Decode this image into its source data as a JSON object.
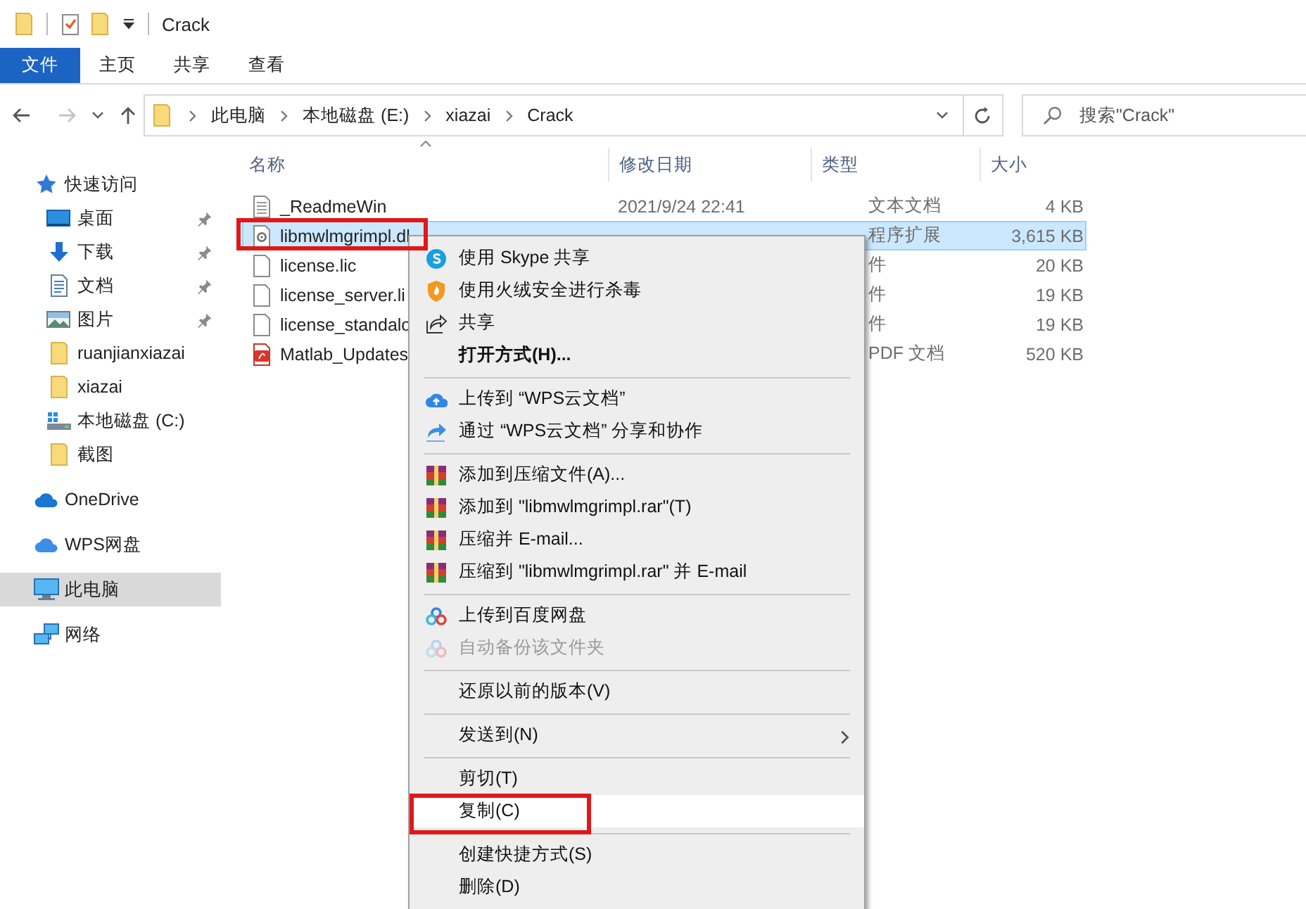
{
  "title_bar": {
    "title": "Crack"
  },
  "ribbon_tabs": [
    {
      "label": "文件",
      "kind": "file"
    },
    {
      "label": "主页",
      "kind": "tab"
    },
    {
      "label": "共享",
      "kind": "tab"
    },
    {
      "label": "查看",
      "kind": "tab"
    }
  ],
  "navigation": {
    "back_disabled": false,
    "forward_disabled": true
  },
  "address_bar": {
    "breadcrumbs": [
      "此电脑",
      "本地磁盘 (E:)",
      "xiazai",
      "Crack"
    ]
  },
  "search": {
    "placeholder": "搜索\"Crack\""
  },
  "sidebar": {
    "items": [
      {
        "label": "快速访问",
        "selected": false,
        "children": [
          {
            "label": "桌面",
            "pinned": true,
            "selected": false
          },
          {
            "label": "下载",
            "pinned": true,
            "selected": false
          },
          {
            "label": "文档",
            "pinned": true,
            "selected": false
          },
          {
            "label": "图片",
            "pinned": true,
            "selected": false
          },
          {
            "label": "ruanjianxiazai",
            "pinned": false,
            "selected": false
          },
          {
            "label": "xiazai",
            "pinned": false,
            "selected": false
          },
          {
            "label": "本地磁盘 (C:)",
            "pinned": false,
            "selected": false
          },
          {
            "label": "截图",
            "pinned": false,
            "selected": false
          }
        ]
      },
      {
        "label": "OneDrive",
        "selected": false
      },
      {
        "label": "WPS网盘",
        "selected": false
      },
      {
        "label": "此电脑",
        "selected": true
      },
      {
        "label": "网络",
        "selected": false
      }
    ]
  },
  "file_list": {
    "columns": [
      {
        "label": "名称",
        "sorted": true
      },
      {
        "label": "修改日期",
        "sorted": false
      },
      {
        "label": "类型",
        "sorted": false
      },
      {
        "label": "大小",
        "sorted": false
      }
    ],
    "rows": [
      {
        "name": "_ReadmeWin",
        "modified": "2021/9/24 22:41",
        "type": "文本文档",
        "size": "4 KB",
        "selected": false,
        "highlighted": false
      },
      {
        "name": "libmwlmgrimpl.dl",
        "type": "程序扩展",
        "size": "3,615 KB",
        "selected": true,
        "highlighted": true
      },
      {
        "name": "license.lic",
        "type": "件",
        "size": "20 KB",
        "selected": false,
        "highlighted": false
      },
      {
        "name": "license_server.li",
        "type": "件",
        "size": "19 KB",
        "selected": false,
        "highlighted": false
      },
      {
        "name": "license_standalo",
        "type": "件",
        "size": "19 KB",
        "selected": false,
        "highlighted": false
      },
      {
        "name": "Matlab_Updates",
        "type": "PDF 文档",
        "size": "520 KB",
        "selected": false,
        "highlighted": false
      }
    ]
  },
  "context_menu": {
    "items": [
      {
        "kind": "item",
        "label": "使用 Skype 共享",
        "bold": false,
        "disabled": false,
        "hovered": false,
        "highlighted": false,
        "submenu": false
      },
      {
        "kind": "item",
        "label": "使用火绒安全进行杀毒",
        "bold": false,
        "disabled": false,
        "hovered": false,
        "highlighted": false,
        "submenu": false
      },
      {
        "kind": "item",
        "label": "共享",
        "bold": false,
        "disabled": false,
        "hovered": false,
        "highlighted": false,
        "submenu": false
      },
      {
        "kind": "item",
        "label": "打开方式(H)...",
        "bold": true,
        "disabled": false,
        "hovered": false,
        "highlighted": false,
        "submenu": false
      },
      {
        "kind": "separator"
      },
      {
        "kind": "item",
        "label": "上传到 “WPS云文档”",
        "bold": false,
        "disabled": false,
        "hovered": false,
        "highlighted": false,
        "submenu": false
      },
      {
        "kind": "item",
        "label": "通过 “WPS云文档” 分享和协作",
        "bold": false,
        "disabled": false,
        "hovered": false,
        "highlighted": false,
        "submenu": false
      },
      {
        "kind": "separator"
      },
      {
        "kind": "item",
        "label": "添加到压缩文件(A)...",
        "bold": false,
        "disabled": false,
        "hovered": false,
        "highlighted": false,
        "submenu": false
      },
      {
        "kind": "item",
        "label": "添加到 \"libmwlmgrimpl.rar\"(T)",
        "bold": false,
        "disabled": false,
        "hovered": false,
        "highlighted": false,
        "submenu": false
      },
      {
        "kind": "item",
        "label": "压缩并 E-mail...",
        "bold": false,
        "disabled": false,
        "hovered": false,
        "highlighted": false,
        "submenu": false
      },
      {
        "kind": "item",
        "label": "压缩到 \"libmwlmgrimpl.rar\" 并 E-mail",
        "bold": false,
        "disabled": false,
        "hovered": false,
        "highlighted": false,
        "submenu": false
      },
      {
        "kind": "separator"
      },
      {
        "kind": "item",
        "label": "上传到百度网盘",
        "bold": false,
        "disabled": false,
        "hovered": false,
        "highlighted": false,
        "submenu": false
      },
      {
        "kind": "item",
        "label": "自动备份该文件夹",
        "bold": false,
        "disabled": true,
        "hovered": false,
        "highlighted": false,
        "submenu": false
      },
      {
        "kind": "separator"
      },
      {
        "kind": "item",
        "label": "还原以前的版本(V)",
        "bold": false,
        "disabled": false,
        "hovered": false,
        "highlighted": false,
        "submenu": false
      },
      {
        "kind": "separator"
      },
      {
        "kind": "item",
        "label": "发送到(N)",
        "bold": false,
        "disabled": false,
        "hovered": false,
        "highlighted": false,
        "submenu": true
      },
      {
        "kind": "separator"
      },
      {
        "kind": "item",
        "label": "剪切(T)",
        "bold": false,
        "disabled": false,
        "hovered": false,
        "highlighted": false,
        "submenu": false
      },
      {
        "kind": "item",
        "label": "复制(C)",
        "bold": false,
        "disabled": false,
        "hovered": true,
        "highlighted": true,
        "submenu": false
      },
      {
        "kind": "separator"
      },
      {
        "kind": "item",
        "label": "创建快捷方式(S)",
        "bold": false,
        "disabled": false,
        "hovered": false,
        "highlighted": false,
        "submenu": false
      },
      {
        "kind": "item",
        "label": "删除(D)",
        "bold": false,
        "disabled": false,
        "hovered": false,
        "highlighted": false,
        "submenu": false
      }
    ]
  }
}
